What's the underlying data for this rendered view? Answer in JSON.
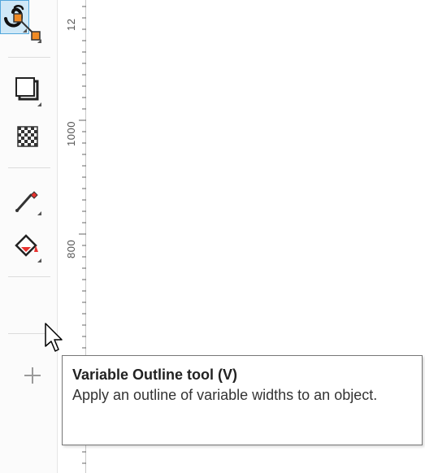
{
  "ruler": {
    "labels": [
      "12",
      "1000",
      "800"
    ]
  },
  "toolbox": {
    "tools": [
      {
        "name": "connector-tool",
        "icon": "connector-line-icon"
      },
      {
        "name": "drop-shadow-tool",
        "icon": "drop-shadow-icon"
      },
      {
        "name": "transparency-tool",
        "icon": "checkerboard-icon"
      },
      {
        "name": "eyedropper-tool",
        "icon": "eyedropper-icon"
      },
      {
        "name": "interactive-fill-tool",
        "icon": "paint-bucket-icon"
      },
      {
        "name": "variable-outline-tool",
        "icon": "variable-outline-icon",
        "selected": true
      },
      {
        "name": "add-tool",
        "icon": "plus-icon"
      }
    ]
  },
  "tooltip": {
    "title": "Variable Outline tool (V)",
    "description": "Apply an outline of variable widths to an object."
  },
  "colors": {
    "selection_fill": "#cfe8f7",
    "selection_border": "#54a7db",
    "accent_red": "#e8322f",
    "accent_orange": "#f08a24"
  }
}
